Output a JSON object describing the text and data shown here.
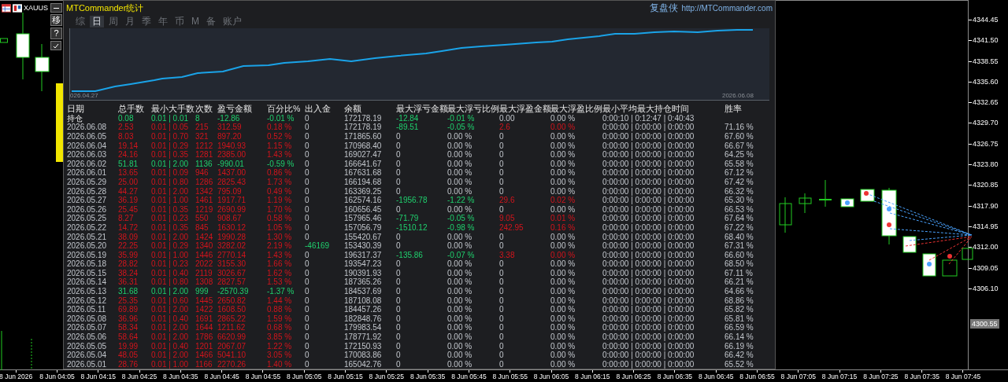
{
  "chart_window": {
    "symbol": "XAUUS",
    "side_buttons": [
      "移",
      "?"
    ]
  },
  "price_axis": {
    "labels": [
      "4344.45",
      "4341.50",
      "4338.55",
      "4335.60",
      "4332.65",
      "4329.70",
      "4326.75",
      "4323.80",
      "4320.85",
      "4317.90",
      "4314.95",
      "4312.00",
      "4309.05",
      "4306.10"
    ],
    "current_price": "4300.55"
  },
  "time_axis": {
    "labels": [
      "8 Jun 2026",
      "8 Jun 04:05",
      "8 Jun 04:15",
      "8 Jun 04:25",
      "8 Jun 04:35",
      "8 Jun 04:45",
      "8 Jun 04:55",
      "8 Jun 05:05",
      "8 Jun 05:15",
      "8 Jun 05:25",
      "8 Jun 05:35",
      "8 Jun 05:45",
      "8 Jun 05:55",
      "8 Jun 06:05",
      "8 Jun 06:15",
      "8 Jun 06:25",
      "8 Jun 06:35",
      "8 Jun 06:45",
      "8 Jun 06:55",
      "8 Jun 07:05",
      "8 Jun 07:15",
      "8 Jun 07:25",
      "8 Jun 07:35",
      "8 Jun 07:45"
    ]
  },
  "stats_panel": {
    "title": "MTCommander统计",
    "brand": "复盘侠",
    "link": "http://MTCommander.com",
    "tabs": [
      {
        "label": "综",
        "selected": false
      },
      {
        "label": "日",
        "selected": true
      },
      {
        "label": "周",
        "selected": false
      },
      {
        "label": "月",
        "selected": false
      },
      {
        "label": "季",
        "selected": false
      },
      {
        "label": "年",
        "selected": false
      },
      {
        "label": "币",
        "selected": false
      },
      {
        "label": "M",
        "selected": false
      },
      {
        "label": "备",
        "selected": false
      },
      {
        "label": "账户",
        "selected": false
      }
    ],
    "equity_chart": {
      "start_label": "026.04.27",
      "end_label": "2026.06.08"
    },
    "table": {
      "columns": [
        "日期",
        "总手数",
        "最小大手数",
        "次数",
        "盈亏金额",
        "百分比%",
        "出入金",
        "余额",
        "最大浮亏金额",
        "最大浮亏比例",
        "最大浮盈金额",
        "最大浮盈比例",
        "最小平均最大持仓时间",
        "胜率"
      ],
      "rows": [
        {
          "open_position": true,
          "in_profit": false,
          "float_loss": true,
          "float_gain": false,
          "deposit": false,
          "cells": [
            "持仓",
            "0.08",
            "0.01 | 0.01",
            "8",
            "-12.86",
            "-0.01 %",
            "0",
            "172178.19",
            "-12.84",
            "-0.01 %",
            "0.00",
            "0.00 %",
            "0:00:10 | 0:12:47 | 0:40:43"
          ]
        },
        {
          "open_position": false,
          "in_profit": true,
          "float_loss": true,
          "float_gain": true,
          "deposit": false,
          "cells": [
            "2026.06.08",
            "2.53",
            "0.01 | 0.05",
            "215",
            "312.59",
            "0.18 %",
            "0",
            "172178.19",
            "-89.51",
            "-0.05 %",
            "2.6",
            "0.00 %",
            "0:00:00 | 0:00:00 | 0:00:00",
            "71.16 %"
          ]
        },
        {
          "open_position": false,
          "in_profit": true,
          "float_loss": false,
          "float_gain": false,
          "deposit": false,
          "cells": [
            "2026.06.05",
            "8.03",
            "0.01 | 0.70",
            "321",
            "897.20",
            "0.52 %",
            "0",
            "171865.60",
            "0",
            "0.00 %",
            "0",
            "0.00 %",
            "0:00:00 | 0:00:00 | 0:00:00",
            "67.60 %"
          ]
        },
        {
          "open_position": false,
          "in_profit": true,
          "float_loss": false,
          "float_gain": false,
          "deposit": false,
          "cells": [
            "2026.06.04",
            "19.14",
            "0.01 | 0.29",
            "1212",
            "1940.93",
            "1.15 %",
            "0",
            "170968.40",
            "0",
            "0.00 %",
            "0",
            "0.00 %",
            "0:00:00 | 0:00:00 | 0:00:00",
            "66.67 %"
          ]
        },
        {
          "open_position": false,
          "in_profit": true,
          "float_loss": false,
          "float_gain": false,
          "deposit": false,
          "cells": [
            "2026.06.03",
            "24.16",
            "0.01 | 0.35",
            "1281",
            "2385.00",
            "1.43 %",
            "0",
            "169027.47",
            "0",
            "0.00 %",
            "0",
            "0.00 %",
            "0:00:00 | 0:00:00 | 0:00:00",
            "64.25 %"
          ]
        },
        {
          "open_position": false,
          "in_profit": false,
          "float_loss": false,
          "float_gain": false,
          "deposit": false,
          "cells": [
            "2026.06.02",
            "51.81",
            "0.01 | 2.00",
            "1136",
            "-990.01",
            "-0.59 %",
            "0",
            "166641.67",
            "0",
            "0.00 %",
            "0",
            "0.00 %",
            "0:00:00 | 0:00:00 | 0:00:00",
            "65.58 %"
          ]
        },
        {
          "open_position": false,
          "in_profit": true,
          "float_loss": false,
          "float_gain": false,
          "deposit": false,
          "cells": [
            "2026.06.01",
            "13.65",
            "0.01 | 0.09",
            "946",
            "1437.00",
            "0.86 %",
            "0",
            "167631.68",
            "0",
            "0.00 %",
            "0",
            "0.00 %",
            "0:00:00 | 0:00:00 | 0:00:00",
            "67.12 %"
          ]
        },
        {
          "open_position": false,
          "in_profit": true,
          "float_loss": false,
          "float_gain": false,
          "deposit": false,
          "cells": [
            "2026.05.29",
            "25.00",
            "0.01 | 0.80",
            "1286",
            "2825.43",
            "1.73 %",
            "0",
            "166194.68",
            "0",
            "0.00 %",
            "0",
            "0.00 %",
            "0:00:00 | 0:00:00 | 0:00:00",
            "67.42 %"
          ]
        },
        {
          "open_position": false,
          "in_profit": true,
          "float_loss": false,
          "float_gain": false,
          "deposit": false,
          "cells": [
            "2026.05.28",
            "44.27",
            "0.01 | 2.00",
            "1342",
            "795.09",
            "0.49 %",
            "0",
            "163369.25",
            "0",
            "0.00 %",
            "0",
            "0.00 %",
            "0:00:00 | 0:00:00 | 0:00:00",
            "66.32 %"
          ]
        },
        {
          "open_position": false,
          "in_profit": true,
          "float_loss": true,
          "float_gain": true,
          "deposit": false,
          "cells": [
            "2026.05.27",
            "36.19",
            "0.01 | 1.00",
            "1461",
            "1917.71",
            "1.19 %",
            "0",
            "162574.16",
            "-1956.78",
            "-1.22 %",
            "29.6",
            "0.02 %",
            "0:00:00 | 0:00:00 | 0:00:00",
            "65.30 %"
          ]
        },
        {
          "open_position": false,
          "in_profit": true,
          "float_loss": false,
          "float_gain": false,
          "deposit": false,
          "cells": [
            "2026.05.26",
            "25.45",
            "0.01 | 0.35",
            "1219",
            "2690.99",
            "1.70 %",
            "0",
            "160656.45",
            "0",
            "0.00 %",
            "0",
            "0.00 %",
            "0:00:00 | 0:00:00 | 0:00:00",
            "66.53 %"
          ]
        },
        {
          "open_position": false,
          "in_profit": true,
          "float_loss": true,
          "float_gain": true,
          "deposit": false,
          "cells": [
            "2026.05.25",
            "8.27",
            "0.01 | 0.23",
            "550",
            "908.67",
            "0.58 %",
            "0",
            "157965.46",
            "-71.79",
            "-0.05 %",
            "9.05",
            "0.01 %",
            "0:00:00 | 0:00:00 | 0:00:00",
            "67.64 %"
          ]
        },
        {
          "open_position": false,
          "in_profit": true,
          "float_loss": true,
          "float_gain": true,
          "deposit": false,
          "cells": [
            "2026.05.22",
            "14.72",
            "0.01 | 0.35",
            "845",
            "1630.12",
            "1.05 %",
            "0",
            "157056.79",
            "-1510.12",
            "-0.98 %",
            "242.95",
            "0.16 %",
            "0:00:00 | 0:00:00 | 0:00:00",
            "67.22 %"
          ]
        },
        {
          "open_position": false,
          "in_profit": true,
          "float_loss": false,
          "float_gain": false,
          "deposit": false,
          "cells": [
            "2026.05.21",
            "38.09",
            "0.01 | 2.00",
            "1424",
            "1990.28",
            "1.30 %",
            "0",
            "155420.67",
            "0",
            "0.00 %",
            "0",
            "0.00 %",
            "0:00:00 | 0:00:00 | 0:00:00",
            "68.40 %"
          ]
        },
        {
          "open_position": false,
          "in_profit": true,
          "float_loss": false,
          "float_gain": false,
          "deposit": true,
          "cells": [
            "2026.05.20",
            "22.25",
            "0.01 | 0.29",
            "1340",
            "3282.02",
            "2.19 %",
            "-46169",
            "153430.39",
            "0",
            "0.00 %",
            "0",
            "0.00 %",
            "0:00:00 | 0:00:00 | 0:00:00",
            "67.31 %"
          ]
        },
        {
          "open_position": false,
          "in_profit": true,
          "float_loss": true,
          "float_gain": true,
          "deposit": false,
          "cells": [
            "2026.05.19",
            "35.99",
            "0.01 | 1.00",
            "1446",
            "2770.14",
            "1.43 %",
            "0",
            "196317.37",
            "-135.86",
            "-0.07 %",
            "3.38",
            "0.00 %",
            "0:00:00 | 0:00:00 | 0:00:00",
            "66.60 %"
          ]
        },
        {
          "open_position": false,
          "in_profit": true,
          "float_loss": false,
          "float_gain": false,
          "deposit": false,
          "cells": [
            "2026.05.18",
            "28.82",
            "0.01 | 0.23",
            "2022",
            "3155.30",
            "1.66 %",
            "0",
            "193547.23",
            "0",
            "0.00 %",
            "0",
            "0.00 %",
            "0:00:00 | 0:00:00 | 0:00:00",
            "68.50 %"
          ]
        },
        {
          "open_position": false,
          "in_profit": true,
          "float_loss": false,
          "float_gain": false,
          "deposit": false,
          "cells": [
            "2026.05.15",
            "38.24",
            "0.01 | 0.40",
            "2119",
            "3026.67",
            "1.62 %",
            "0",
            "190391.93",
            "0",
            "0.00 %",
            "0",
            "0.00 %",
            "0:00:00 | 0:00:00 | 0:00:00",
            "67.11 %"
          ]
        },
        {
          "open_position": false,
          "in_profit": true,
          "float_loss": false,
          "float_gain": false,
          "deposit": false,
          "cells": [
            "2026.05.14",
            "36.31",
            "0.01 | 0.80",
            "1308",
            "2827.57",
            "1.53 %",
            "0",
            "187365.26",
            "0",
            "0.00 %",
            "0",
            "0.00 %",
            "0:00:00 | 0:00:00 | 0:00:00",
            "66.21 %"
          ]
        },
        {
          "open_position": false,
          "in_profit": false,
          "float_loss": false,
          "float_gain": false,
          "deposit": false,
          "cells": [
            "2026.05.13",
            "31.68",
            "0.01 | 2.00",
            "999",
            "-2570.39",
            "-1.37 %",
            "0",
            "184537.69",
            "0",
            "0.00 %",
            "0",
            "0.00 %",
            "0:00:00 | 0:00:00 | 0:00:00",
            "64.66 %"
          ]
        },
        {
          "open_position": false,
          "in_profit": true,
          "float_loss": false,
          "float_gain": false,
          "deposit": false,
          "cells": [
            "2026.05.12",
            "25.35",
            "0.01 | 0.60",
            "1445",
            "2650.82",
            "1.44 %",
            "0",
            "187108.08",
            "0",
            "0.00 %",
            "0",
            "0.00 %",
            "0:00:00 | 0:00:00 | 0:00:00",
            "68.86 %"
          ]
        },
        {
          "open_position": false,
          "in_profit": true,
          "float_loss": false,
          "float_gain": false,
          "deposit": false,
          "cells": [
            "2026.05.11",
            "69.89",
            "0.01 | 2.00",
            "1422",
            "1608.50",
            "0.88 %",
            "0",
            "184457.26",
            "0",
            "0.00 %",
            "0",
            "0.00 %",
            "0:00:00 | 0:00:00 | 0:00:00",
            "65.82 %"
          ]
        },
        {
          "open_position": false,
          "in_profit": true,
          "float_loss": false,
          "float_gain": false,
          "deposit": false,
          "cells": [
            "2026.05.08",
            "36.96",
            "0.01 | 0.40",
            "1691",
            "2865.22",
            "1.59 %",
            "0",
            "182848.76",
            "0",
            "0.00 %",
            "0",
            "0.00 %",
            "0:00:00 | 0:00:00 | 0:00:00",
            "65.81 %"
          ]
        },
        {
          "open_position": false,
          "in_profit": true,
          "float_loss": false,
          "float_gain": false,
          "deposit": false,
          "cells": [
            "2026.05.07",
            "58.34",
            "0.01 | 2.00",
            "1644",
            "1211.62",
            "0.68 %",
            "0",
            "179983.54",
            "0",
            "0.00 %",
            "0",
            "0.00 %",
            "0:00:00 | 0:00:00 | 0:00:00",
            "66.59 %"
          ]
        },
        {
          "open_position": false,
          "in_profit": true,
          "float_loss": false,
          "float_gain": false,
          "deposit": false,
          "cells": [
            "2026.05.06",
            "58.64",
            "0.01 | 2.00",
            "1786",
            "6620.99",
            "3.85 %",
            "0",
            "178771.92",
            "0",
            "0.00 %",
            "0",
            "0.00 %",
            "0:00:00 | 0:00:00 | 0:00:00",
            "66.14 %"
          ]
        },
        {
          "open_position": false,
          "in_profit": true,
          "float_loss": false,
          "float_gain": false,
          "deposit": false,
          "cells": [
            "2026.05.05",
            "19.99",
            "0.01 | 0.40",
            "1201",
            "2067.07",
            "1.22 %",
            "0",
            "172150.93",
            "0",
            "0.00 %",
            "0",
            "0.00 %",
            "0:00:00 | 0:00:00 | 0:00:00",
            "66.19 %"
          ]
        },
        {
          "open_position": false,
          "in_profit": true,
          "float_loss": false,
          "float_gain": false,
          "deposit": false,
          "cells": [
            "2026.05.04",
            "48.05",
            "0.01 | 2.00",
            "1466",
            "5041.10",
            "3.05 %",
            "0",
            "170083.86",
            "0",
            "0.00 %",
            "0",
            "0.00 %",
            "0:00:00 | 0:00:00 | 0:00:00",
            "66.42 %"
          ]
        },
        {
          "open_position": false,
          "in_profit": true,
          "float_loss": false,
          "float_gain": false,
          "deposit": false,
          "cells": [
            "2026.05.01",
            "28.76",
            "0.01 | 1.00",
            "1166",
            "2270.26",
            "1.40 %",
            "0",
            "165042.76",
            "0",
            "0.00 %",
            "0",
            "0.00 %",
            "0:00:00 | 0:00:00 | 0:00:00",
            "65.52 %"
          ]
        }
      ]
    }
  }
}
